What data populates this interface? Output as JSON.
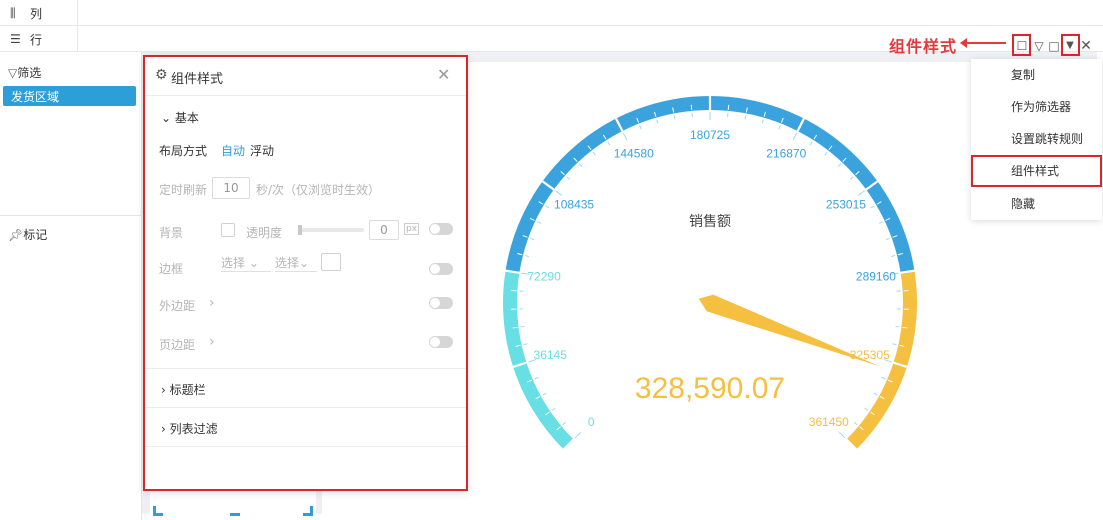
{
  "fields": {
    "column": {
      "icon": "columns-icon",
      "label": "列"
    },
    "row": {
      "icon": "rows-icon",
      "label": "行"
    }
  },
  "left": {
    "filter_label": "筛选",
    "filter_chip": "发货区域",
    "mark_label": "标记"
  },
  "annotation": "组件样式",
  "menu": {
    "items": [
      "复制",
      "作为筛选器",
      "设置跳转规则",
      "组件样式",
      "隐藏"
    ],
    "highlighted_index": 3
  },
  "panel": {
    "title": "组件样式",
    "section_basic": "基本",
    "layout_label": "布局方式",
    "layout_auto": "自动",
    "layout_float": "浮动",
    "refresh_label": "定时刷新",
    "refresh_value": "10",
    "refresh_unit": "秒/次（仅浏览时生效）",
    "bg_label": "背景",
    "opacity_label": "透明度",
    "opacity_value": "0",
    "opacity_unit": "px",
    "border_label": "边框",
    "border_select1": "选择",
    "border_select2": "选择",
    "margin_label": "外边距",
    "padding_label": "页边距",
    "section_title_bar": "标题栏",
    "section_list_filter": "列表过滤"
  },
  "gauge": {
    "title": "销售额",
    "value_text": "328,590.07",
    "value": 328590.07,
    "min": 0,
    "max": 361450,
    "ticks": [
      "0",
      "36145",
      "72290",
      "108435",
      "144580",
      "180725",
      "216870",
      "253015",
      "289160",
      "325305",
      "361450"
    ],
    "colors": {
      "low": "#67dfe4",
      "mid": "#3aa3dd",
      "high": "#f5bf3f"
    }
  }
}
